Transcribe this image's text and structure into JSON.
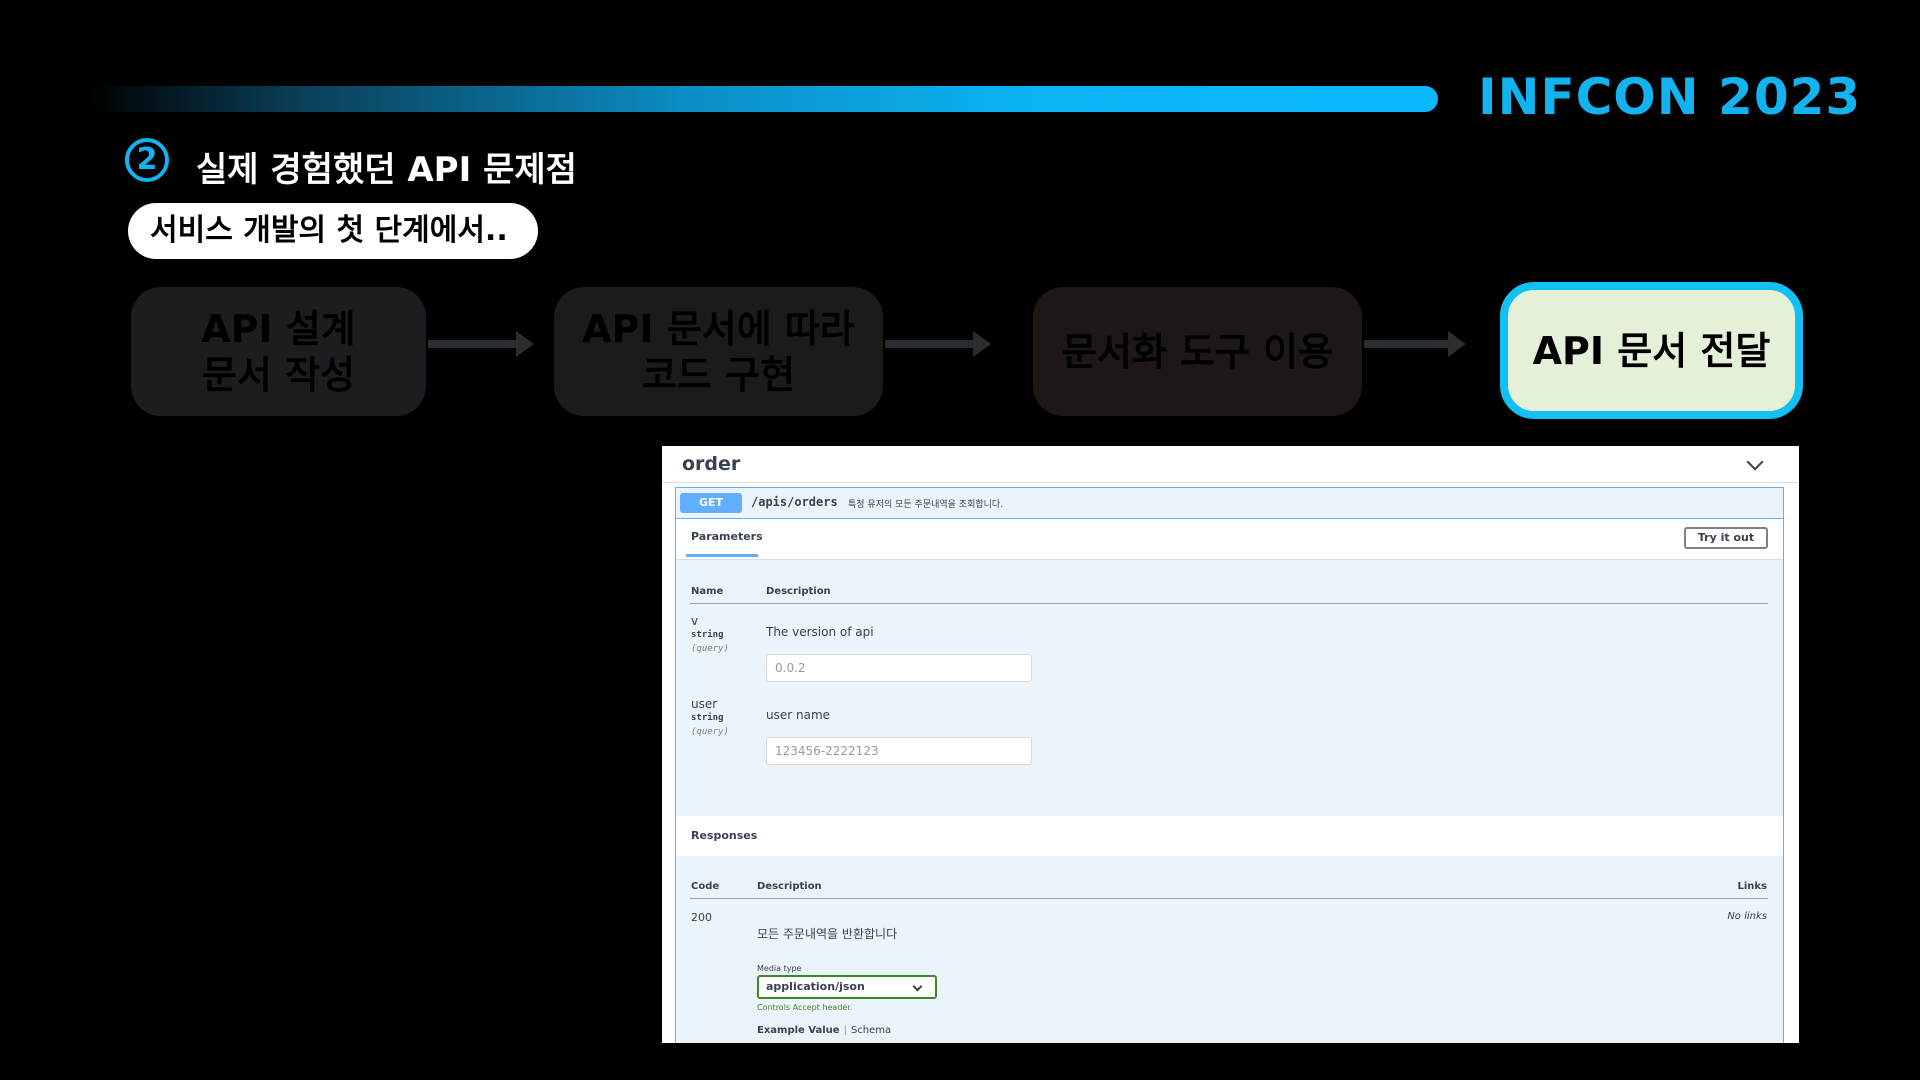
{
  "brand": "INFCON 2023",
  "section": {
    "number": "2",
    "title": "실제 경험했던 API 문제점"
  },
  "subtitle": "서비스 개발의 첫 단계에서..",
  "steps": [
    {
      "label": "API 설계\n문서 작성"
    },
    {
      "label": "API 문서에 따라\n코드 구현"
    },
    {
      "label": "문서화 도구 이용"
    },
    {
      "label": "API 문서 전달"
    }
  ],
  "swagger": {
    "tag": "order",
    "method": "GET",
    "path": "/apis/orders",
    "summary": "특정 유저의 모든 주문내역을 조회합니다.",
    "params_tab": "Parameters",
    "try_button": "Try it out",
    "col_name": "Name",
    "col_description": "Description",
    "params": [
      {
        "name": "v",
        "type": "string",
        "in": "(query)",
        "description": "The version of api",
        "placeholder": "0.0.2"
      },
      {
        "name": "user",
        "type": "string",
        "in": "(query)",
        "description": "user name",
        "placeholder": "123456-2222123"
      }
    ],
    "responses_title": "Responses",
    "resp_col_code": "Code",
    "resp_col_description": "Description",
    "resp_col_links": "Links",
    "response": {
      "code": "200",
      "description": "모든 주문내역을 반환합니다",
      "links": "No links",
      "media_type_label": "Media type",
      "media_type": "application/json",
      "accept_note": "Controls Accept header.",
      "example_value": "Example Value",
      "schema": "Schema"
    }
  }
}
